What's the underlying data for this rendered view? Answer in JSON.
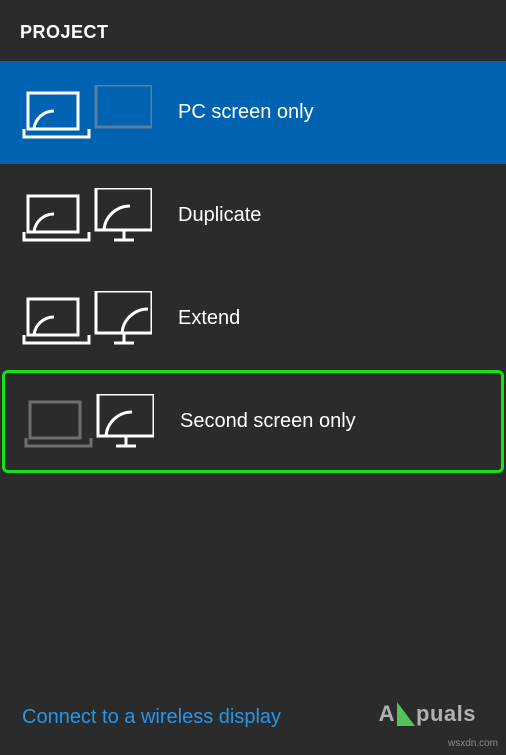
{
  "header": {
    "title": "PROJECT"
  },
  "options": [
    {
      "id": "pc-screen-only",
      "label": "PC screen only",
      "selected": true,
      "highlighted": false
    },
    {
      "id": "duplicate",
      "label": "Duplicate",
      "selected": false,
      "highlighted": false
    },
    {
      "id": "extend",
      "label": "Extend",
      "selected": false,
      "highlighted": false
    },
    {
      "id": "second-screen-only",
      "label": "Second screen only",
      "selected": false,
      "highlighted": true
    }
  ],
  "footer": {
    "link": "Connect to a wireless display"
  },
  "watermark": {
    "prefix": "A",
    "suffix": "puals"
  },
  "attribution": "wsxdn.com"
}
